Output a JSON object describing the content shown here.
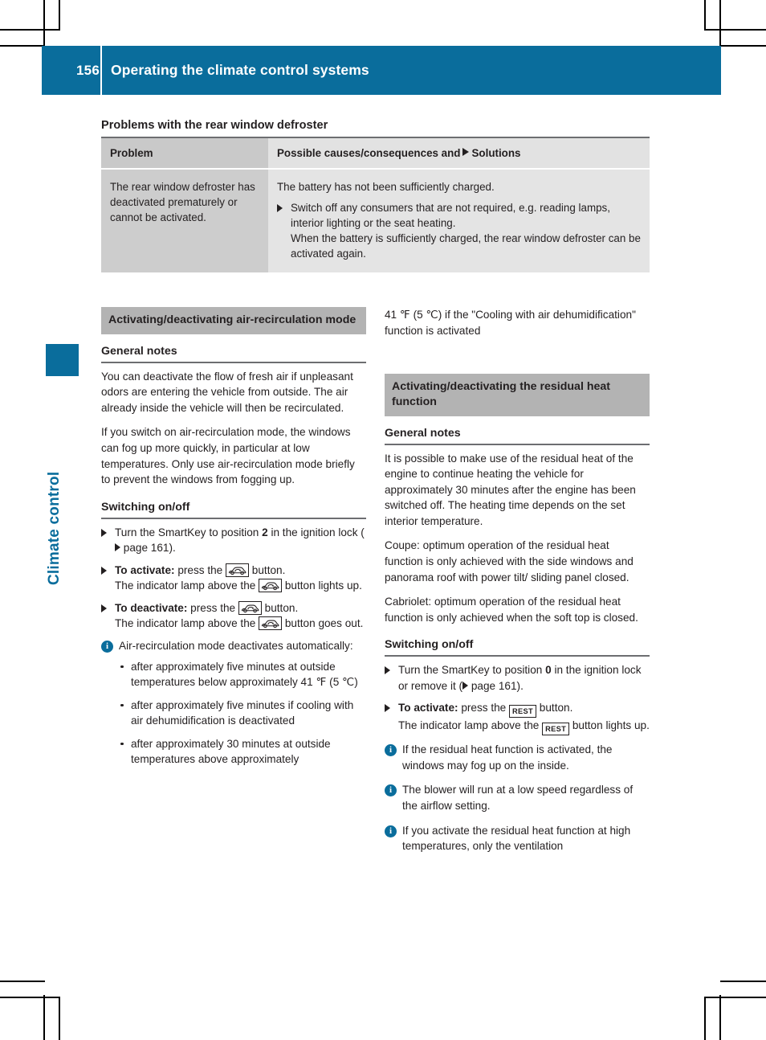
{
  "colors": {
    "accent": "#0a6d9c",
    "table_header_left": "#c9c9c9",
    "table_header_right": "#e2e2e2",
    "table_cell_left": "#cdcdcd",
    "table_cell_right": "#e4e4e4",
    "subhead_band": "#b3b3b3"
  },
  "header": {
    "page_number": "156",
    "title": "Operating the climate control systems"
  },
  "chapter_tab": {
    "label": "Climate control"
  },
  "section": {
    "title": "Problems with the rear window defroster"
  },
  "table": {
    "headers": {
      "problem": "Problem",
      "solution_before": "Possible causes/consequences and",
      "solution_after": "Solutions"
    },
    "rows": [
      {
        "problem": "The rear window defroster has deactivated prematurely or cannot be activated.",
        "cause": "The battery has not been sufficiently charged.",
        "solution_step": "Switch off any consumers that are not required, e.g. reading lamps, interior lighting or the seat heating.",
        "solution_extra": "When the battery is sufficiently charged, the rear window defroster can be activated again."
      }
    ]
  },
  "left_column": {
    "band_title": "Activating/deactivating air-recirculation mode",
    "general_notes_heading": "General notes",
    "paragraphs": [
      "You can deactivate the flow of fresh air if unpleasant odors are entering the vehicle from outside. The air already inside the vehicle will then be recirculated.",
      "If you switch on air-recirculation mode, the windows can fog up more quickly, in particular at low temperatures. Only use air-recirculation mode briefly to prevent the windows from fogging up."
    ],
    "switching_heading": "Switching on/off",
    "step1_a": "Turn the SmartKey to position ",
    "step1_bold": "2",
    "step1_b": " in the ignition lock (",
    "step1_c": " page 161).",
    "step2_bold": "To activate:",
    "step2_a": " press the ",
    "step2_b": " button.",
    "step2_c": "The indicator lamp above the ",
    "step2_d": " button lights up.",
    "step3_bold": "To deactivate:",
    "step3_a": " press the ",
    "step3_b": " button.",
    "step3_c": "The indicator lamp above the ",
    "step3_d": " button goes out.",
    "note_text": "Air-recirculation mode deactivates automatically:",
    "note_bullets": [
      "after approximately five minutes at outside temperatures below approximately 41 ℉ (5 ℃)",
      "after approximately five minutes if cooling with air dehumidification is deactivated",
      "after approximately 30 minutes at outside temperatures above approximately"
    ],
    "recirc_button_name": "air-recirculation button",
    "info_glyph": "i"
  },
  "right_column": {
    "continuation_text": "41 ℉ (5 ℃) if the \"Cooling with air dehumidification\" function is activated",
    "band_title": "Activating/deactivating the residual heat function",
    "general_notes_heading": "General notes",
    "paragraphs": [
      "It is possible to make use of the residual heat of the engine to continue heating the vehicle for approximately 30 minutes after the engine has been switched off. The heating time depends on the set interior temperature.",
      "Coupe: optimum operation of the residual heat function is only achieved with the side windows and panorama roof with power tilt/ sliding panel closed.",
      "Cabriolet: optimum operation of the residual heat function is only achieved when the soft top is closed."
    ],
    "switching_heading": "Switching on/off",
    "step1_a": "Turn the SmartKey to position ",
    "step1_bold": "0",
    "step1_b": " in the ignition lock or remove it (",
    "step1_c": " page 161).",
    "step2_bold": "To activate:",
    "step2_a": " press the ",
    "step2_b": " button.",
    "step2_c": "The indicator lamp above the ",
    "step2_d": " button lights up.",
    "rest_button_label": "REST",
    "notes": [
      "If the residual heat function is activated, the windows may fog up on the inside.",
      "The blower will run at a low speed regardless of the airflow setting.",
      "If you activate the residual heat function at high temperatures, only the ventilation"
    ],
    "info_glyph": "i"
  }
}
